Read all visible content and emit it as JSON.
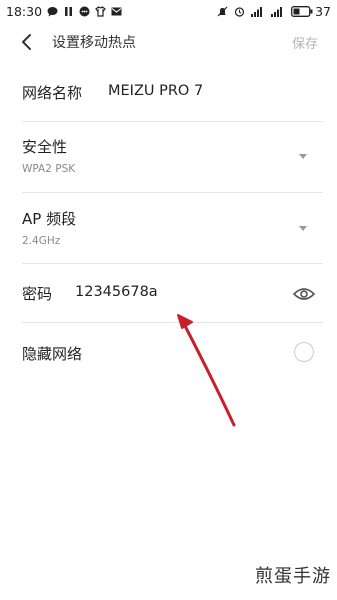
{
  "status_bar": {
    "time": "18:30",
    "battery_level": "37",
    "left_icons": [
      "chat-bubble-icon",
      "pause-icon",
      "message-icon",
      "shirt-icon",
      "mail-icon"
    ],
    "right_icons": [
      "mute-icon",
      "alarm-icon",
      "signal-icon",
      "signal-icon",
      "battery-icon"
    ]
  },
  "header": {
    "title": "设置移动热点",
    "save_label": "保存"
  },
  "settings": {
    "network_name": {
      "label": "网络名称",
      "value": "MEIZU PRO 7"
    },
    "security": {
      "label": "安全性",
      "value": "WPA2 PSK"
    },
    "ap_band": {
      "label": "AP 频段",
      "value": "2.4GHz"
    },
    "password": {
      "label": "密码",
      "value": "12345678a"
    },
    "hidden_network": {
      "label": "隐藏网络",
      "checked": false
    }
  },
  "watermark": "煎蛋手游",
  "colors": {
    "annotation_arrow": "#c8202a",
    "save_disabled": "#b3b3b3",
    "subtext": "#8a8a8a",
    "divider": "#e6e6e6"
  }
}
